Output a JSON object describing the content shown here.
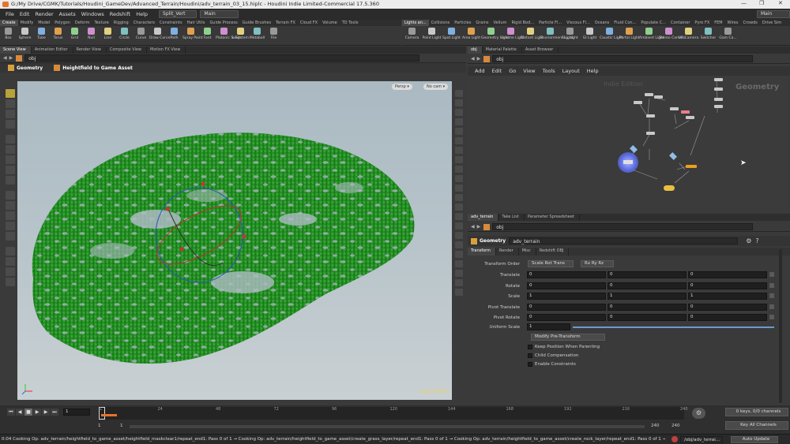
{
  "window": {
    "title": "G:/My Drive/CGMK/Tutorials/Houdini_GameDev/Advanced_Terrain/Houdini/adv_terrain_03_15.hiplc - Houdini Indie Limited-Commercial 17.5.360",
    "minimize": "—",
    "maximize": "❐",
    "close": "✕"
  },
  "menubar": {
    "items": [
      "File",
      "Edit",
      "Render",
      "Assets",
      "Windows",
      "Redshift",
      "Help"
    ],
    "desktop": "Split_Vert",
    "context": "Main",
    "right_desktop": "Main"
  },
  "shelf_left": {
    "tabs": [
      "Create",
      "Modify",
      "Model",
      "Polygon",
      "Deform",
      "Texture",
      "Rigging",
      "Characters",
      "Constraints",
      "Hair Utils",
      "Guide Process",
      "Guide Brushes",
      "Terrain FX",
      "Cloud FX",
      "Volume",
      "TD Tools"
    ],
    "tools": [
      "Box",
      "Sphere",
      "Tube",
      "Torus",
      "Grid",
      "Null",
      "Line",
      "Circle",
      "Curve",
      "Draw Curve",
      "Path",
      "Spray Paint",
      "Font",
      "Platonic Solids",
      "L-System",
      "Metaball",
      "File"
    ]
  },
  "shelf_right": {
    "tabs": [
      "Lights an...",
      "Collisions",
      "Particles",
      "Grains",
      "Vellum",
      "Rigid Bod...",
      "Particle Fl...",
      "Viscous Fl...",
      "Oceans",
      "Fluid Con...",
      "Populate C...",
      "Container",
      "Pyro FX",
      "FEM",
      "Wires",
      "Crowds",
      "Drive Sim"
    ],
    "tools": [
      "Camera",
      "Point Light",
      "Spot Light",
      "Area Light",
      "Geometry Light",
      "Volume Light",
      "Distant Light",
      "Environment Light",
      "Sky Light",
      "GI Light",
      "Caustic Light",
      "Portal Light",
      "Ambient Light",
      "Stereo Camera",
      "VR Camera",
      "Switcher",
      "Gam Ca..."
    ]
  },
  "left_pane": {
    "tabs": [
      "Scene View",
      "Animation Editor",
      "Render View",
      "Composite View",
      "Motion FX View"
    ],
    "path": "obj",
    "breadcrumb_geo": "Geometry",
    "breadcrumb_asset": "Heightfield to Game Asset",
    "persp": "Persp ▾",
    "nocam": "No cam ▾",
    "watermark": "Indie Edition"
  },
  "network_pane": {
    "tabs": [
      "obj",
      "Material Palette",
      "Asset Browser"
    ],
    "path": "obj",
    "menu": [
      "Add",
      "Edit",
      "Go",
      "View",
      "Tools",
      "Layout",
      "Help"
    ],
    "watermark": "Indie Edition",
    "context_label": "Geometry"
  },
  "params_pane": {
    "tabs": [
      "adv_terrain",
      "Take List",
      "Parameter Spreadsheet"
    ],
    "path": "obj",
    "node_type": "Geometry",
    "node_name": "adv_terrain",
    "subtabs": [
      "Transform",
      "Render",
      "Misc",
      "Redshift OBJ"
    ],
    "transform_order_label": "Transform Order",
    "transform_order": "Scale Rot Trans",
    "rot_order": "Rx Ry Rz",
    "rows": [
      {
        "label": "Translate",
        "values": [
          "0",
          "0",
          "0"
        ]
      },
      {
        "label": "Rotate",
        "values": [
          "0",
          "0",
          "0"
        ]
      },
      {
        "label": "Scale",
        "values": [
          "1",
          "1",
          "1"
        ]
      },
      {
        "label": "Pivot Translate",
        "values": [
          "0",
          "0",
          "0"
        ]
      },
      {
        "label": "Pivot Rotate",
        "values": [
          "0",
          "0",
          "0"
        ]
      }
    ],
    "uniform_scale_label": "Uniform Scale",
    "uniform_scale": "1",
    "modify_btn": "Modify Pre-Transform",
    "checks": [
      "Keep Position When Parenting",
      "Child Compensation",
      "Enable Constraints"
    ]
  },
  "timeline": {
    "frame": "1",
    "start": "1",
    "start2": "1",
    "end": "240",
    "end2": "240",
    "ticks": [
      "1",
      "24",
      "48",
      "72",
      "96",
      "120",
      "144",
      "168",
      "192",
      "216",
      "240"
    ],
    "keys": "0 keys, 0/0 channels",
    "key_all": "Key All Channels",
    "auto_update": "Auto Update",
    "scene_path": "/obj/adv_terrai..."
  },
  "status": {
    "text": "0:04 Cooking Op: adv_terrain/heightfield_to_game_asset/heightfield_maskclear1/repeat_end1: Pass 0 of 1 → Cooking Op: adv_terrain/heightfield_to_game_asset/create_grass_layer/repeat_end1: Pass 0 of 1 → Cooking Op: adv_terrain/heightfield_to_game_asset/create_rock_layer/repeat_end1: Pass 0 of 1 → Cooking"
  },
  "icons": {
    "houdini": "houdini-logo",
    "cursor": "mouse-pointer-icon"
  },
  "colors": {
    "foliage": "#1f8a1f",
    "node_selected": "#7a8ae0",
    "node_pink": "#e87f8e",
    "node_orange": "#e8a020",
    "accent": "#e8732a"
  }
}
